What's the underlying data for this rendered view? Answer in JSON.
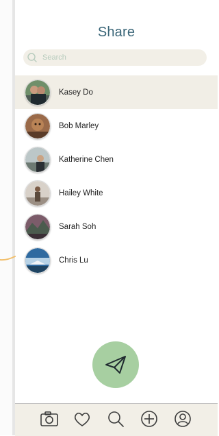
{
  "header": {
    "title": "Share"
  },
  "search": {
    "placeholder": "Search",
    "value": ""
  },
  "contacts": [
    {
      "name": "Kasey Do",
      "selected": true
    },
    {
      "name": "Bob Marley",
      "selected": false
    },
    {
      "name": "Katherine Chen",
      "selected": false
    },
    {
      "name": "Hailey White",
      "selected": false
    },
    {
      "name": "Sarah Soh",
      "selected": false
    },
    {
      "name": "Chris Lu",
      "selected": false
    }
  ],
  "actions": {
    "send_icon": "paper-plane-icon"
  },
  "bottom_nav": [
    {
      "icon": "camera-icon"
    },
    {
      "icon": "heart-icon"
    },
    {
      "icon": "search-icon"
    },
    {
      "icon": "plus-circle-icon"
    },
    {
      "icon": "profile-icon"
    }
  ],
  "colors": {
    "title": "#3a6678",
    "search_bg": "#f2efe7",
    "selected_row": "#f1eee6",
    "fab": "#a7cfa1",
    "nav_bg": "#f2efe7"
  }
}
